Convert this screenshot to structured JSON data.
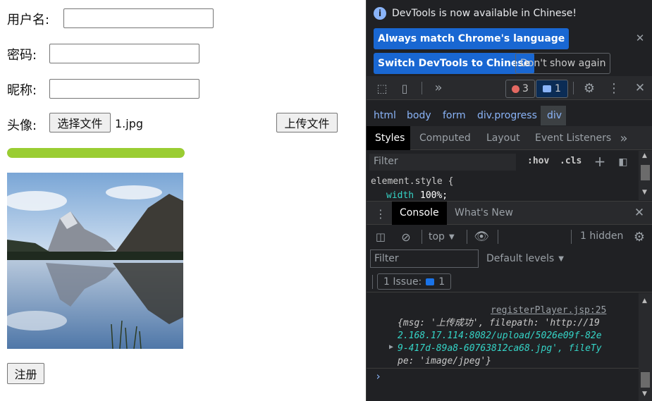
{
  "form": {
    "username_label": "用户名:",
    "password_label": "密码:",
    "nickname_label": "昵称:",
    "avatar_label": "头像:",
    "choose_file_button": "选择文件",
    "file_name": "1.jpg",
    "upload_button": "上传文件",
    "progress": 1.0,
    "register_button": "注册"
  },
  "devtools": {
    "infobar": {
      "message": "DevTools is now available in Chinese!",
      "always_match": "Always match Chrome's language",
      "switch_chinese": "Switch DevTools to Chinese",
      "dont_show": "Don't show again"
    },
    "toolbar": {
      "errors_count": "3",
      "messages_count": "1"
    },
    "breadcrumbs": [
      "html",
      "body",
      "form",
      "div.progress",
      "div"
    ],
    "tabs": [
      "Styles",
      "Computed",
      "Layout",
      "Event Listeners"
    ],
    "styles": {
      "filter_placeholder": "Filter",
      "hov": ":hov",
      "cls": ".cls",
      "rule_selector": "element.style {",
      "prop_name": "width",
      "prop_value": "100%;"
    },
    "drawer": {
      "tabs": [
        "Console",
        "What's New"
      ],
      "context": "top",
      "hidden": "1 hidden",
      "filter_placeholder": "Filter",
      "levels": "Default levels",
      "issues_label": "1 Issue:",
      "issues_count": "1",
      "log_source": "registerPlayer.jsp:25",
      "log_line1": "{msg: '上传成功', filepath: 'http://19",
      "log_line2": "2.168.17.114:8082/upload/5026e09f-82e",
      "log_line3": "9-417d-89a8-60763812ca68.jpg', fileTy",
      "log_line4": "pe: 'image/jpeg'}",
      "prompt": "›"
    }
  },
  "colors": {
    "accent": "#1967d2",
    "progress": "#9acd32",
    "devtools_bg": "#202124"
  }
}
